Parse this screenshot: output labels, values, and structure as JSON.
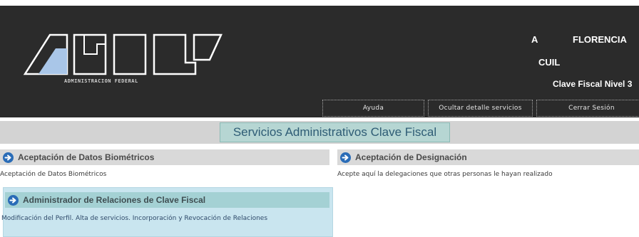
{
  "header": {
    "logo_caption": "ADMINISTRACION FEDERAL",
    "user_initial": "A",
    "user_name": "FLORENCIA",
    "cuil_label": "CUIL",
    "level": "Clave Fiscal Nivel 3",
    "buttons": {
      "help": "Ayuda",
      "hide_details": "Ocultar detalle servicios",
      "logout": "Cerrar Sesión"
    }
  },
  "page_title": "Servicios Administrativos Clave Fiscal",
  "services": [
    {
      "title": "Aceptación de Datos Biométricos",
      "description": "Aceptación de Datos Biométricos"
    },
    {
      "title": "Aceptación de Designación",
      "description": "Acepte aquí la delegaciones que otras personas le hayan realizado"
    },
    {
      "title": "Administrador de Relaciones de Clave Fiscal",
      "description": "Modificación del Perfil. Alta de servicios. Incorporación y Revocación de Relaciones"
    }
  ],
  "colors": {
    "header_bg": "#2b2b2b",
    "title_bg": "#b6d6d3",
    "title_text": "#2e5c75",
    "arrow_icon": "#2a6cb7",
    "highlight_card_bg": "#c9e5ef"
  },
  "icons": {
    "logo": "afip-logo",
    "service_arrow": "arrow-right-circle-icon"
  }
}
